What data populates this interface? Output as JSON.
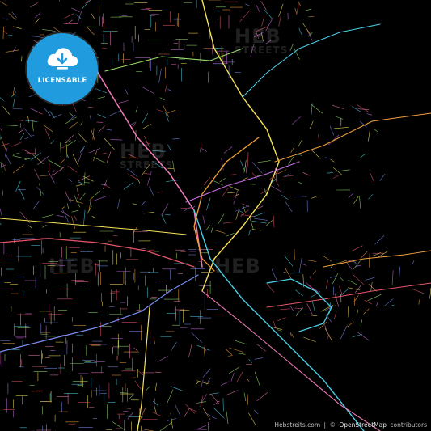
{
  "badge": {
    "label": "LICENSABLE",
    "icon": "cloud-download-icon",
    "color": "#1f9bde"
  },
  "watermark": {
    "text": "HEB",
    "subtext": "STREETS"
  },
  "attribution": {
    "site": "Hebstreits.com",
    "separator": "|",
    "copyright": "©",
    "osm": "OpenStreetMap",
    "contributors": "contributors"
  },
  "colors": {
    "background": "#000000",
    "road_palette": [
      "#e8556b",
      "#f2a03a",
      "#f7e25a",
      "#4bd0e8",
      "#7a8cf0",
      "#c46de0",
      "#f07ab8",
      "#9be06b"
    ]
  }
}
